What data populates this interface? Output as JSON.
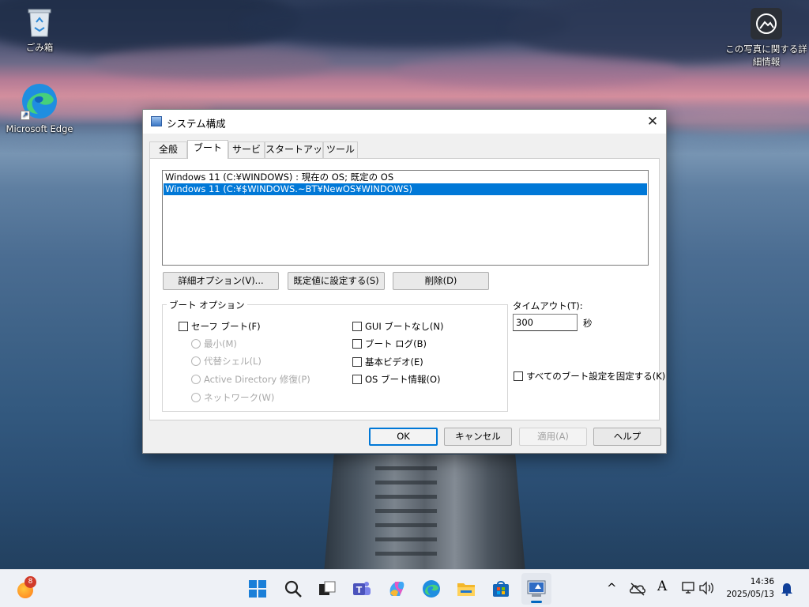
{
  "desktop": {
    "icons": [
      {
        "label": "ごみ箱",
        "icon": "recycle-bin-icon"
      },
      {
        "label": "Microsoft Edge",
        "icon": "edge-icon"
      },
      {
        "label_line1": "この写真に関する詳",
        "label_line2": "細情報",
        "icon": "photo-info-icon"
      }
    ]
  },
  "dialog": {
    "title": "システム構成",
    "tabs": [
      "全般",
      "ブート",
      "サービス",
      "スタートアップ",
      "ツール"
    ],
    "active_tab": "ブート",
    "boot_entries": [
      {
        "text": "Windows 11 (C:¥WINDOWS) : 現在の OS; 既定の OS",
        "selected": false
      },
      {
        "text": "Windows 11 (C:¥$WINDOWS.~BT¥NewOS¥WINDOWS)",
        "selected": true
      }
    ],
    "list_buttons": {
      "advanced": "詳細オプション(V)...",
      "set_default": "既定値に設定する(S)",
      "delete": "削除(D)"
    },
    "boot_options": {
      "legend": "ブート オプション",
      "safe_boot": "セーフ ブート(F)",
      "minimal": "最小(M)",
      "alternate_shell": "代替シェル(L)",
      "ad_repair": "Active Directory 修復(P)",
      "network": "ネットワーク(W)",
      "no_gui_boot": "GUI ブートなし(N)",
      "boot_log": "ブート ログ(B)",
      "base_video": "基本ビデオ(E)",
      "os_boot_info": "OS ブート情報(O)"
    },
    "timeout": {
      "label": "タイムアウト(T):",
      "value": "300",
      "unit": "秒"
    },
    "make_permanent": "すべてのブート設定を固定する(K)",
    "footer": {
      "ok": "OK",
      "cancel": "キャンセル",
      "apply": "適用(A)",
      "help": "ヘルプ"
    },
    "close_glyph": "✕"
  },
  "taskbar": {
    "widget_badge": "8",
    "apps": [
      "start-icon",
      "search-icon",
      "task-view-icon",
      "teams-icon",
      "copilot-icon",
      "edge-icon",
      "file-explorer-icon",
      "store-icon",
      "system-config-icon"
    ],
    "tray": {
      "chevron": "^",
      "ime": "A",
      "time": "14:36",
      "date": "2025/05/13"
    }
  },
  "colors": {
    "selection": "#0078d7",
    "accent": "#0078d7",
    "dialog_bg": "#f0f0f0",
    "taskbar_bg": "#eef1f6"
  }
}
